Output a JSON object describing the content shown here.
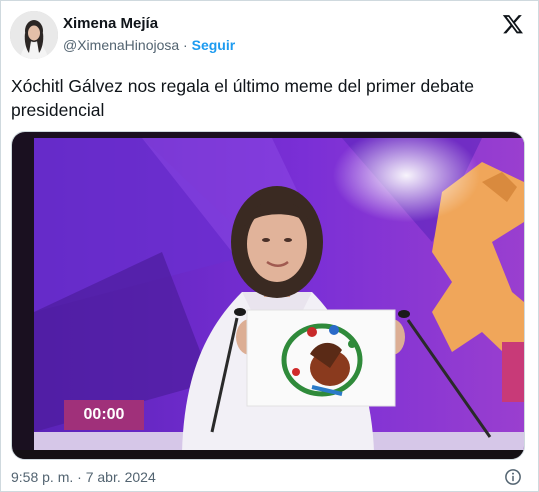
{
  "author": {
    "name": "Ximena Mejía",
    "handle": "@XimenaHinojosa",
    "separator": " · ",
    "follow_label": "Seguir"
  },
  "tweet": {
    "text": "Xóchitl Gálvez nos regala el último meme del primer debate presidencial",
    "timestamp": "9:58 p. m. · 7 abr. 2024"
  },
  "media": {
    "timer": "00:00"
  },
  "icons": {
    "platform": "x-logo-icon",
    "info": "info-icon"
  },
  "colors": {
    "accent": "#1d9bf0",
    "muted": "#536471",
    "stage_purple": "#6a2bd6",
    "timer_bg": "#a0307a"
  }
}
